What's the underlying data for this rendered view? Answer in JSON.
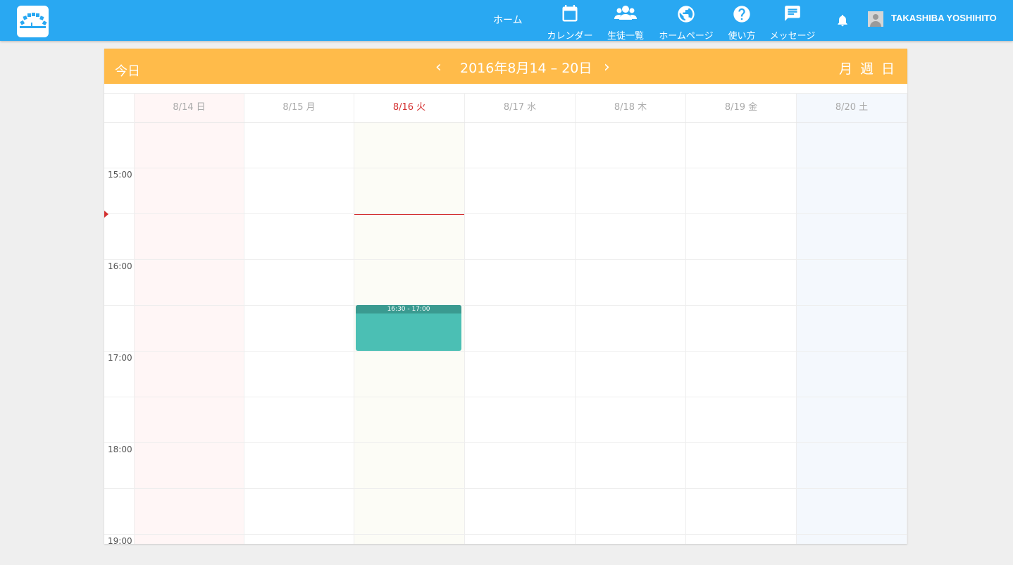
{
  "nav": {
    "home": "ホーム",
    "items": [
      {
        "label": "カレンダー",
        "icon": "calendar-icon"
      },
      {
        "label": "生徒一覧",
        "icon": "people-icon"
      },
      {
        "label": "ホームページ",
        "icon": "globe-icon"
      },
      {
        "label": "使い方",
        "icon": "help-icon"
      },
      {
        "label": "メッセージ",
        "icon": "message-icon"
      }
    ],
    "bell_icon": "bell-icon",
    "user_name": "TAKASHIBA YOSHIHITO"
  },
  "calendar": {
    "today_label": "今日",
    "prev_label": "‹",
    "next_label": "›",
    "range_title": "2016年8月14 – 20日",
    "views": {
      "month": "月",
      "week": "週",
      "day": "日"
    },
    "days": [
      {
        "label": "8/14 日",
        "type": "sunday"
      },
      {
        "label": "8/15 月",
        "type": "weekday"
      },
      {
        "label": "8/16 火",
        "type": "today"
      },
      {
        "label": "8/17 水",
        "type": "weekday"
      },
      {
        "label": "8/18 木",
        "type": "weekday"
      },
      {
        "label": "8/19 金",
        "type": "weekday"
      },
      {
        "label": "8/20 土",
        "type": "saturday"
      }
    ],
    "time_labels": [
      "15:00",
      "16:00",
      "17:00",
      "18:00",
      "19:00"
    ],
    "events": [
      {
        "day": "8/16 火",
        "time": "16:30 - 17:00"
      }
    ],
    "colors": {
      "topbar": "#29a8f2",
      "header": "#ffbb4a",
      "sunday_bg": "#fff6f6",
      "today_bg": "#fcfcf6",
      "saturday_bg": "#f4f8fd",
      "event": "#4bbfb4",
      "now_line": "#d32f2f"
    }
  }
}
